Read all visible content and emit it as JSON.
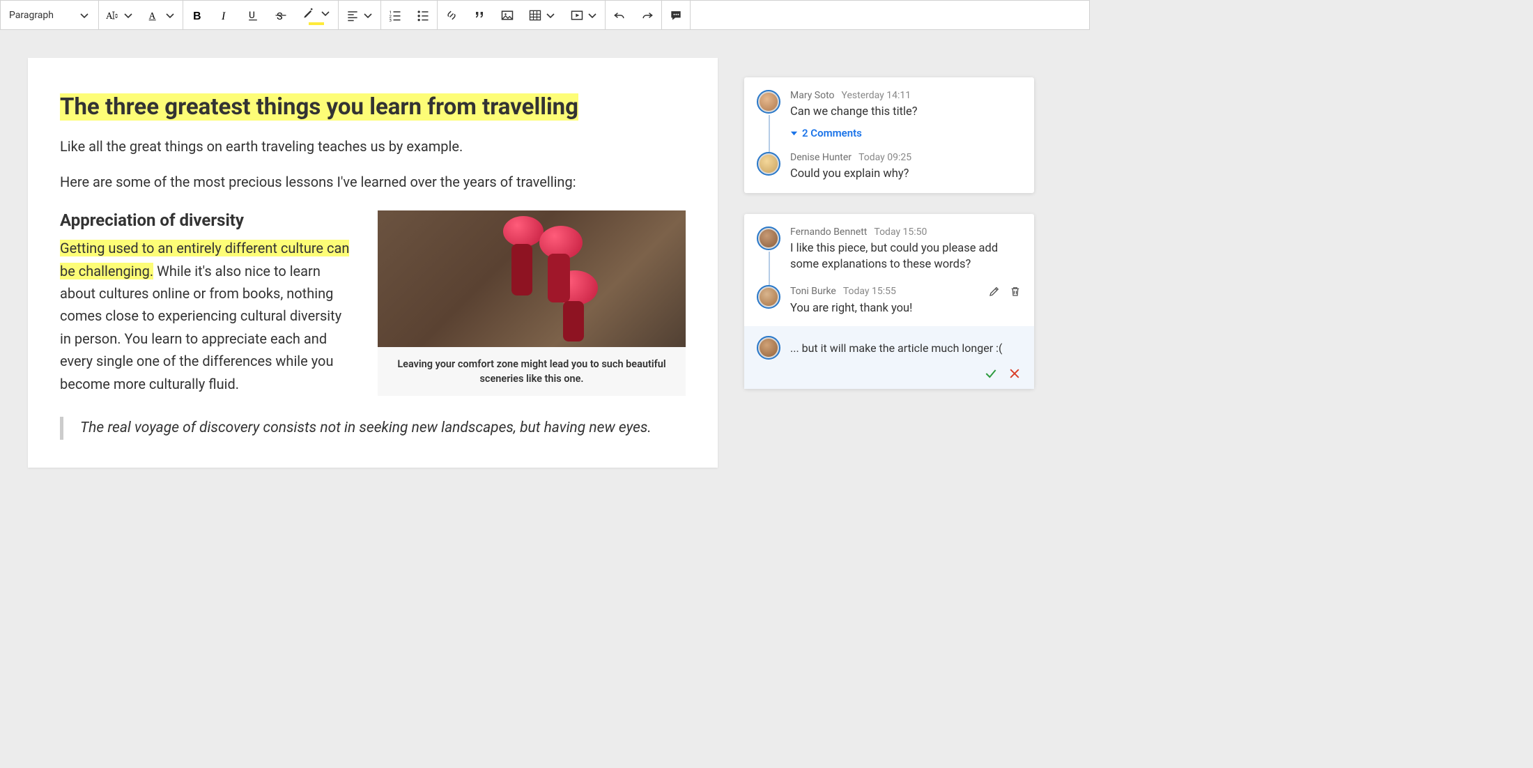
{
  "toolbar": {
    "paragraph_label": "Paragraph"
  },
  "document": {
    "title": "The three greatest things you learn from travelling",
    "intro1": "Like all the great things on earth traveling teaches us by example.",
    "intro2": "Here are some of the most precious lessons I've learned over the years of travelling:",
    "section_heading": "Appreciation of diversity",
    "highlighted_body": "Getting used to an entirely different culture can be challenging.",
    "body_rest": " While it's also nice to learn about cultures online or from books, nothing comes close to experiencing cultural diversity in person. You learn to appreciate each and every single one of the differences while you become more culturally fluid.",
    "caption": "Leaving your comfort zone might lead you to such beautiful sceneries like this one.",
    "quote": "The real voyage of discovery consists not in seeking new landscapes, but having new eyes."
  },
  "comments": {
    "thread1": {
      "c1": {
        "author": "Mary Soto",
        "time": "Yesterday 14:11",
        "text": "Can we change this title?"
      },
      "toggle": "2 Comments",
      "c2": {
        "author": "Denise Hunter",
        "time": "Today 09:25",
        "text": "Could you explain why?"
      }
    },
    "thread2": {
      "c1": {
        "author": "Fernando Bennett",
        "time": "Today 15:50",
        "text": "I like this piece, but could you please add some explanations to these words?"
      },
      "c2": {
        "author": "Toni Burke",
        "time": "Today 15:55",
        "text": "You are right, thank you!"
      },
      "reply_draft": "... but it will make the article much longer :("
    }
  }
}
